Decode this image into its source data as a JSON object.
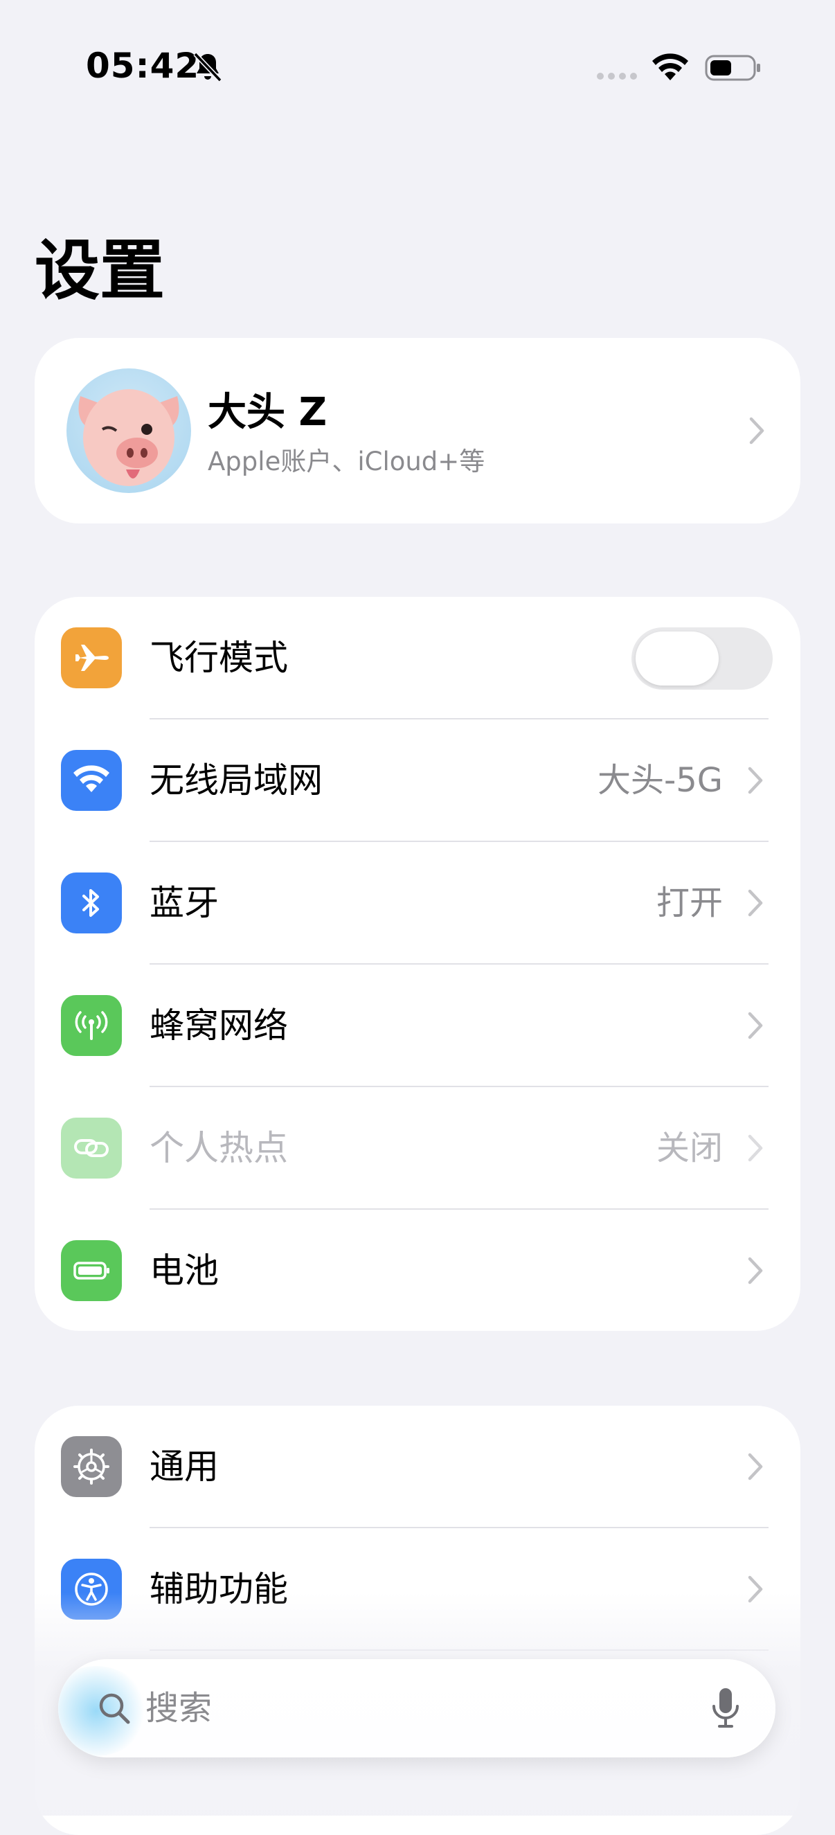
{
  "status_bar": {
    "time": "05:42",
    "icons": [
      "bell-slash-icon",
      "signal-icon",
      "wifi-icon",
      "battery-icon"
    ]
  },
  "page": {
    "title": "设置"
  },
  "account": {
    "name": "大头 Z",
    "subtitle": "Apple账户、iCloud+等",
    "avatar": "pig-memoji"
  },
  "group1": {
    "rows": [
      {
        "label": "飞行模式",
        "icon": "airplane-icon",
        "color": "#f2a33a",
        "toggle": false
      },
      {
        "label": "无线局域网",
        "value": "大头-5G",
        "icon": "wifi-icon",
        "color": "#3b82f6"
      },
      {
        "label": "蓝牙",
        "value": "打开",
        "icon": "bluetooth-icon",
        "color": "#3b82f6"
      },
      {
        "label": "蜂窝网络",
        "icon": "antenna-icon",
        "color": "#5ac85a"
      },
      {
        "label": "个人热点",
        "value": "关闭",
        "icon": "hotspot-icon",
        "color": "#5ac85a",
        "disabled": true
      },
      {
        "label": "电池",
        "icon": "battery-icon",
        "color": "#5ac85a"
      }
    ]
  },
  "group2": {
    "rows": [
      {
        "label": "通用",
        "icon": "gear-icon",
        "color": "#8e8e93"
      },
      {
        "label": "辅助功能",
        "icon": "accessibility-icon",
        "color": "#3b82f6"
      }
    ]
  },
  "search": {
    "placeholder": "搜索"
  },
  "colors": {
    "background": "#f2f2f7",
    "card": "#ffffff",
    "secondary_text": "#8a8a8e"
  }
}
